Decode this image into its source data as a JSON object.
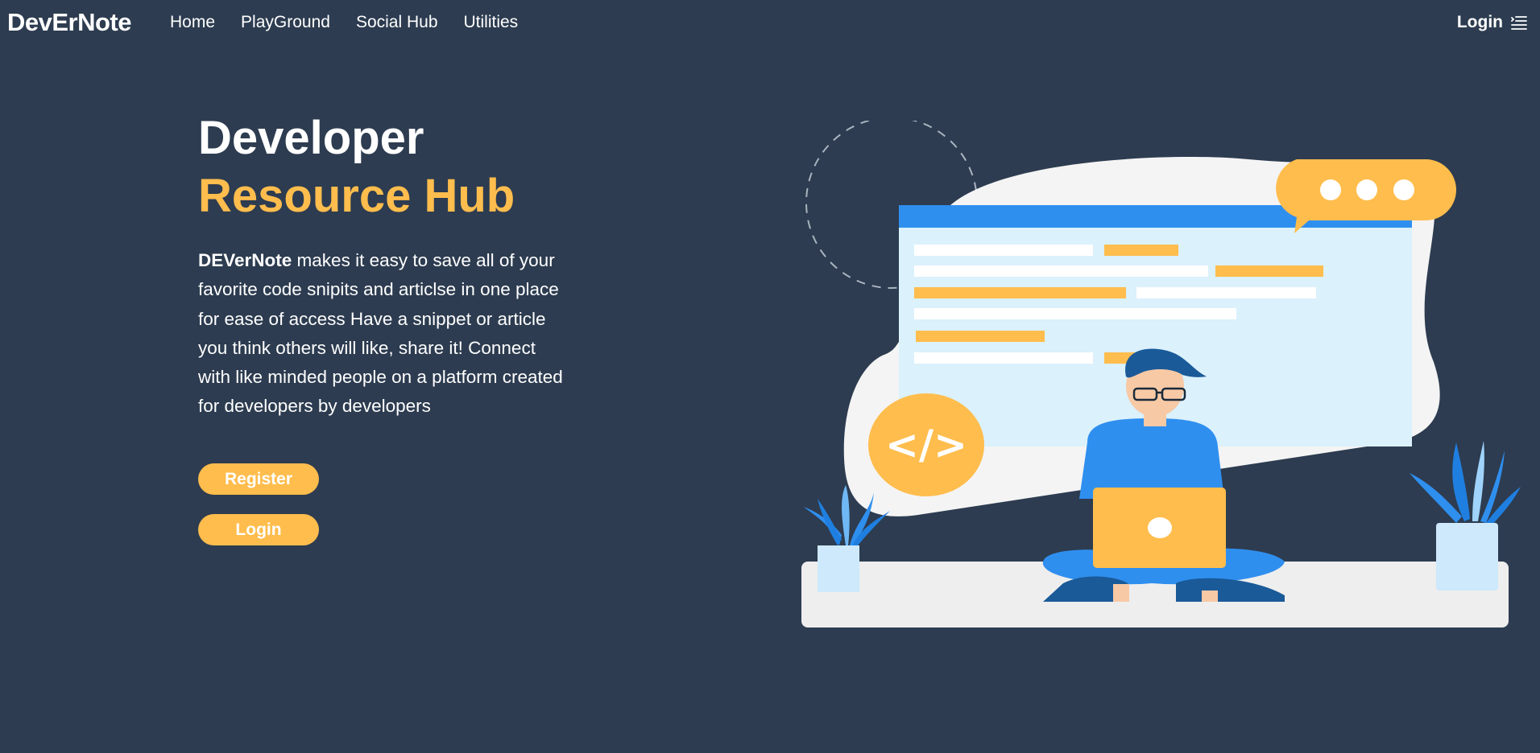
{
  "nav": {
    "brand": "DevErNote",
    "links": [
      "Home",
      "PlayGround",
      "Social Hub",
      "Utilities"
    ],
    "login_label": "Login",
    "menu_icon": "menu-lines-icon"
  },
  "hero": {
    "title_line1": "Developer",
    "title_line2": "Resource Hub",
    "description_brand": "DEVerNote",
    "description_body": " makes it easy to save all of your favorite code snipits and articlse in one place for ease of access Have a snippet or article you think others will like, share it! Connect with like minded people on a platform created for developers by developers",
    "register_label": "Register",
    "login_label": "Login"
  },
  "illustration": {
    "code_badge": "</>"
  },
  "colors": {
    "background": "#2d3c50",
    "accent": "#ffbd4d",
    "blue": "#2f8fef",
    "dark_blue": "#1a5a99"
  }
}
